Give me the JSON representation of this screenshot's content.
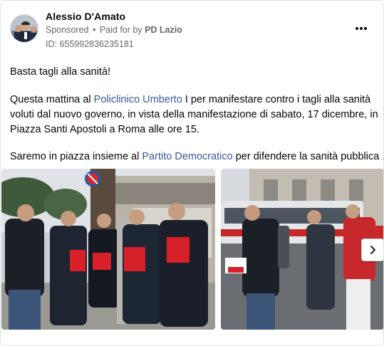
{
  "post": {
    "author": "Alessio D'Amato",
    "sponsored_label": "Sponsored",
    "separator": "•",
    "paid_prefix": "Paid for by",
    "paid_by": "PD Lazio",
    "id_line": "ID: 655992836235181",
    "more_icon": "more-horizontal-icon"
  },
  "text": {
    "headline": "Basta tagli alla sanità!",
    "para1_a": "Questa mattina al ",
    "para1_link": "Policlinico Umberto",
    "para1_b": " I per manifestare contro i tagli alla sanità voluti dal nuovo governo, in vista della manifestazione di sabato, 17 dicembre, in Piazza Santi Apostoli a Roma alle ore 15.",
    "para2_a": "Saremo in piazza insieme al ",
    "para2_link": "Partito Democratico",
    "para2_b": " per difendere la sanità pubblica ..."
  },
  "carousel": {
    "images": [
      {
        "alt": "Group of men holding red flyers in front of a hospital street"
      },
      {
        "alt": "Men distributing flyers by a bus on the street"
      }
    ],
    "next_icon": "chevron-right-icon"
  },
  "colors": {
    "link": "#385898",
    "muted": "#65676b",
    "flyer_red": "#d8202b"
  }
}
